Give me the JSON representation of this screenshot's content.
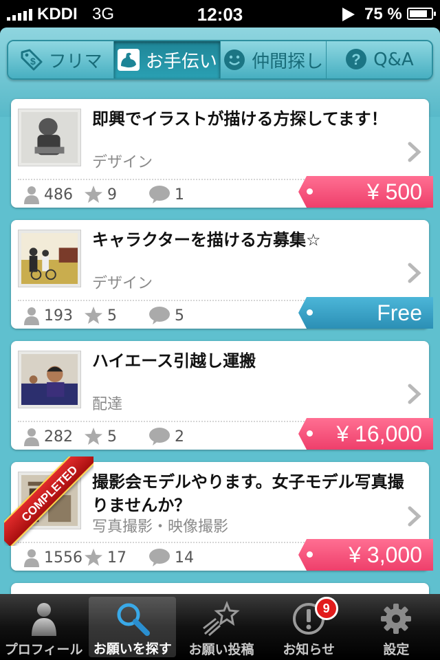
{
  "status_bar": {
    "carrier": "KDDI",
    "network": "3G",
    "time": "12:03",
    "battery": "75 %",
    "battery_level": 0.75
  },
  "segments": [
    {
      "label": "フリマ",
      "icon": "price-tag-icon",
      "active": false
    },
    {
      "label": "お手伝い",
      "icon": "flexed-arm-icon",
      "active": true
    },
    {
      "label": "仲間探し",
      "icon": "smiley-icon",
      "active": false
    },
    {
      "label": "Q&A",
      "icon": "question-icon",
      "active": false
    }
  ],
  "listings": [
    {
      "title": "即興でイラストが描ける方探してます！",
      "category": "デザイン",
      "views": "486",
      "stars": "9",
      "comments": "1",
      "price": "¥ 500",
      "price_style": "pink",
      "completed": false
    },
    {
      "title": "キャラクターを描ける方募集☆",
      "category": "デザイン",
      "views": "193",
      "stars": "5",
      "comments": "5",
      "price": "Free",
      "price_style": "blue",
      "completed": false
    },
    {
      "title": "ハイエース引越し運搬",
      "category": "配達",
      "views": "282",
      "stars": "5",
      "comments": "2",
      "price": "¥ 16,000",
      "price_style": "pink",
      "completed": false
    },
    {
      "title": "撮影会モデルやります。女子モデル写真撮りませんか？",
      "category": "写真撮影・映像撮影",
      "views": "1556",
      "stars": "17",
      "comments": "14",
      "price": "¥ 3,000",
      "price_style": "pink",
      "completed": true,
      "ribbon": "COMPLETED"
    }
  ],
  "tab_bar": [
    {
      "label": "プロフィール",
      "icon": "person-icon",
      "active": false
    },
    {
      "label": "お願いを探す",
      "icon": "magnifier-icon",
      "active": true
    },
    {
      "label": "お願い投稿",
      "icon": "shooting-star-icon",
      "active": false
    },
    {
      "label": "お知らせ",
      "icon": "exclamation-icon",
      "active": false,
      "badge": "9"
    },
    {
      "label": "設定",
      "icon": "gear-icon",
      "active": false
    }
  ],
  "colors": {
    "pink_tag": "#ee3f6b",
    "blue_tag": "#2b8fb5",
    "app_bg": "#5fc0cf",
    "completed_ribbon": "#c81818"
  }
}
